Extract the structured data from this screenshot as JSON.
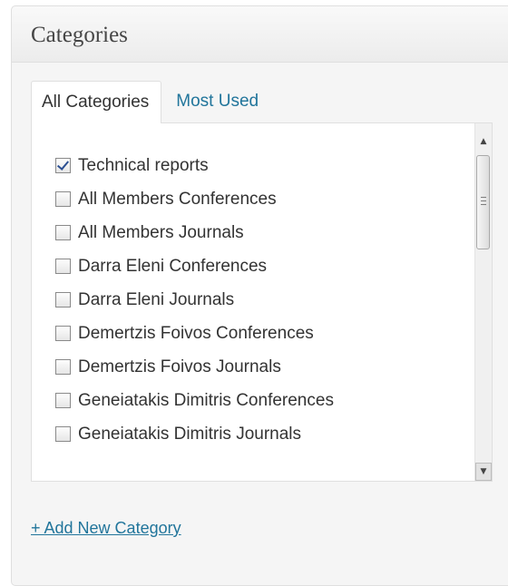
{
  "panel": {
    "title": "Categories"
  },
  "tabs": [
    {
      "label": "All Categories",
      "active": true
    },
    {
      "label": "Most Used",
      "active": false
    }
  ],
  "categories": [
    {
      "label": "Technical reports",
      "checked": true
    },
    {
      "label": "All Members Conferences",
      "checked": false
    },
    {
      "label": "All Members Journals",
      "checked": false
    },
    {
      "label": "Darra Eleni Conferences",
      "checked": false
    },
    {
      "label": "Darra Eleni Journals",
      "checked": false
    },
    {
      "label": "Demertzis Foivos Conferences",
      "checked": false
    },
    {
      "label": "Demertzis Foivos Journals",
      "checked": false
    },
    {
      "label": "Geneiatakis Dimitris Conferences",
      "checked": false
    },
    {
      "label": "Geneiatakis Dimitris Journals",
      "checked": false
    }
  ],
  "add_link": "+ Add New Category",
  "colors": {
    "link": "#21759b",
    "text": "#333333",
    "title": "#464646"
  },
  "icons": {
    "scroll_up": "triangle-up-icon",
    "scroll_down": "triangle-down-icon",
    "thumb_grip": "grip-lines-icon"
  }
}
